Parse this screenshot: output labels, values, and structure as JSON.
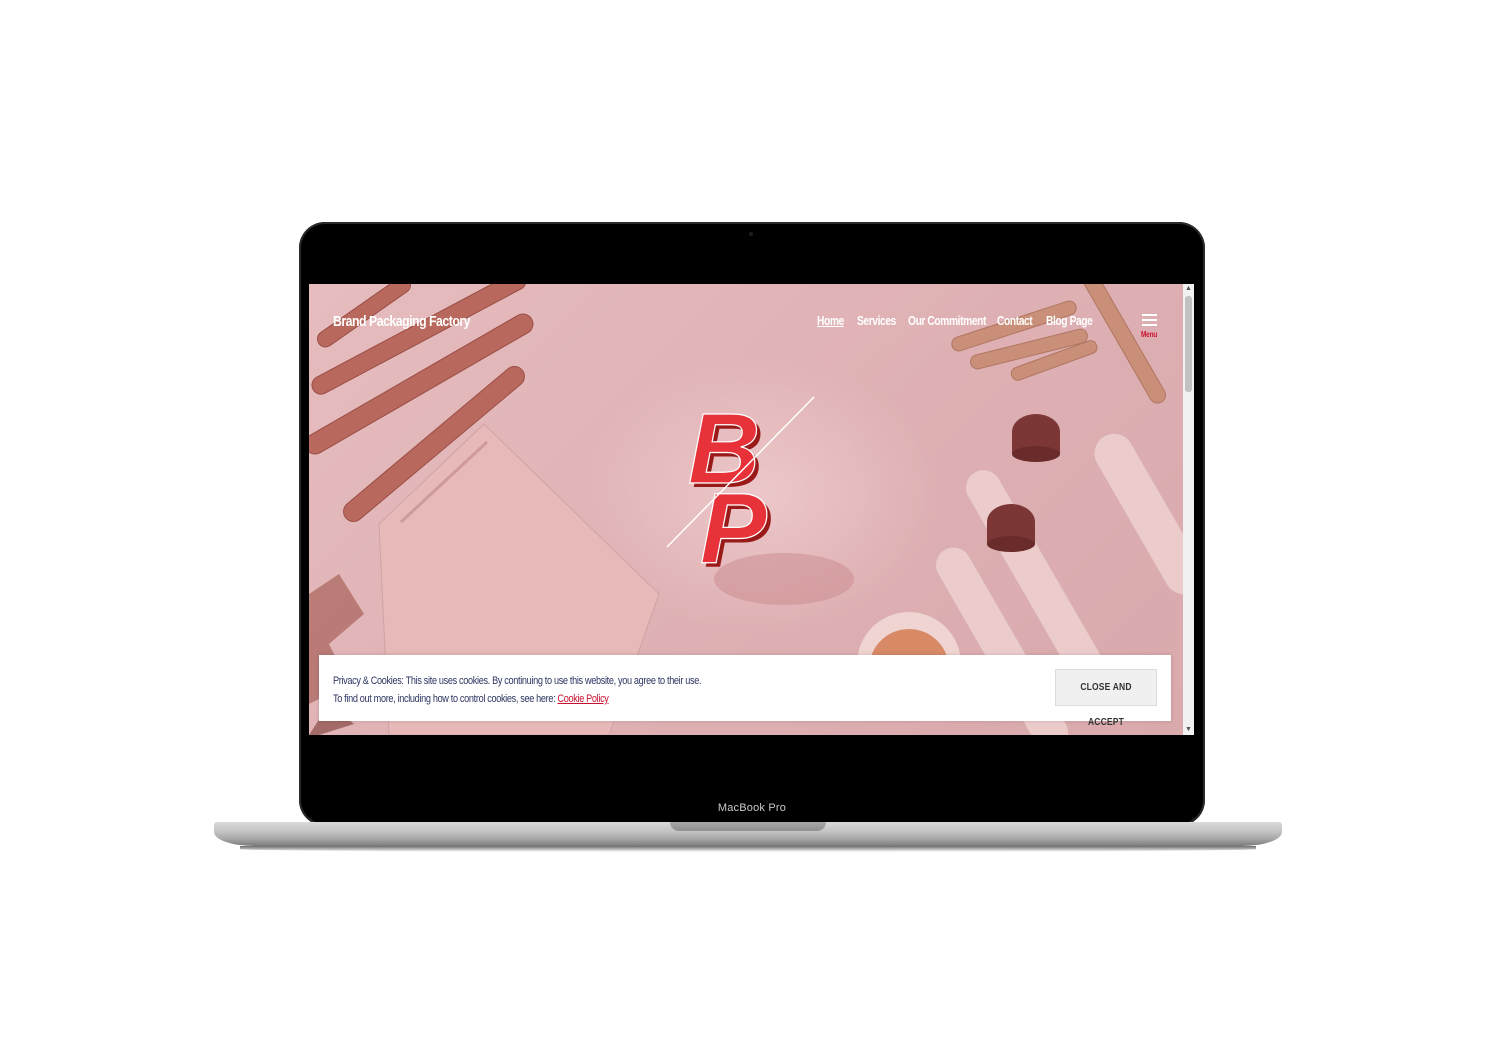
{
  "device": {
    "model_label": "MacBook Pro"
  },
  "site": {
    "title": "Brand Packaging Factory",
    "nav": [
      {
        "label": "Home",
        "active": true
      },
      {
        "label": "Services",
        "active": false
      },
      {
        "label": "Our Commitment",
        "active": false
      },
      {
        "label": "Contact",
        "active": false
      },
      {
        "label": "Blog Page",
        "active": false
      }
    ],
    "menu_label": "Menu",
    "logo_letters": "BP",
    "accent_color": "#c8102e",
    "hero_tint": "#e2b8ba"
  },
  "cookie_banner": {
    "line1": "Privacy & Cookies: This site uses cookies. By continuing to use this website, you agree to their use.",
    "line2": "To find out more, including how to control cookies, see here:",
    "link_label": "Cookie Policy",
    "button_label": "CLOSE AND ACCEPT"
  }
}
